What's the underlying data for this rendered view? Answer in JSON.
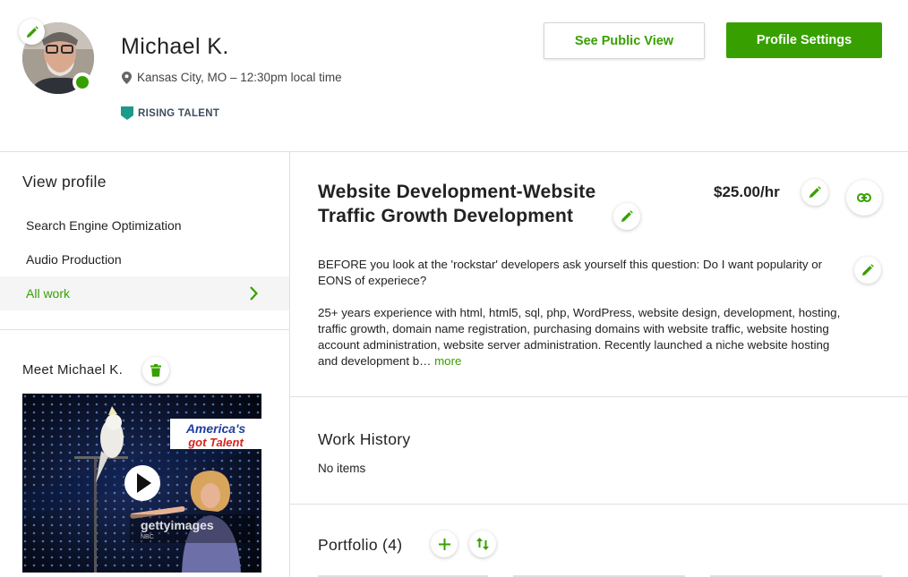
{
  "profile": {
    "name": "Michael K.",
    "location": "Kansas City, MO – 12:30pm local time",
    "badge": "RISING TALENT",
    "status": "online"
  },
  "header": {
    "public_view_label": "See Public View",
    "settings_label": "Profile Settings"
  },
  "sidebar": {
    "heading": "View profile",
    "items": [
      {
        "label": "Search Engine Optimization"
      },
      {
        "label": "Audio Production"
      },
      {
        "label": "All work",
        "active": true
      }
    ],
    "meet_label": "Meet Michael K.",
    "video": {
      "brand_line1": "America's",
      "brand_line2": "got Talent",
      "watermark": "gettyimages",
      "watermark_sub": "NBC"
    }
  },
  "main": {
    "title": "Website Development-Website Traffic Growth Development",
    "rate": "$25.00/hr",
    "description_p1": "BEFORE you look at the 'rockstar' developers ask yourself this question: Do I want popularity or EONS of experiece?",
    "description_p2": "25+ years experience with html, html5, sql, php, WordPress, website design, development, hosting, traffic growth, domain name registration, purchasing domains with website traffic, website hosting account administration, website server administration. Recently launched a niche website hosting and development b…",
    "more_label": "more",
    "work_history_title": "Work History",
    "work_history_empty": "No items",
    "portfolio_title": "Portfolio (4)"
  },
  "colors": {
    "accent": "#37a000",
    "badge": "#1d9a8a",
    "divider": "#e0e0e0"
  },
  "icons": [
    "pencil-icon",
    "map-pin-icon",
    "badge-icon",
    "chevron-right-icon",
    "trash-icon",
    "play-icon",
    "link-icon",
    "plus-icon",
    "sort-icon"
  ]
}
